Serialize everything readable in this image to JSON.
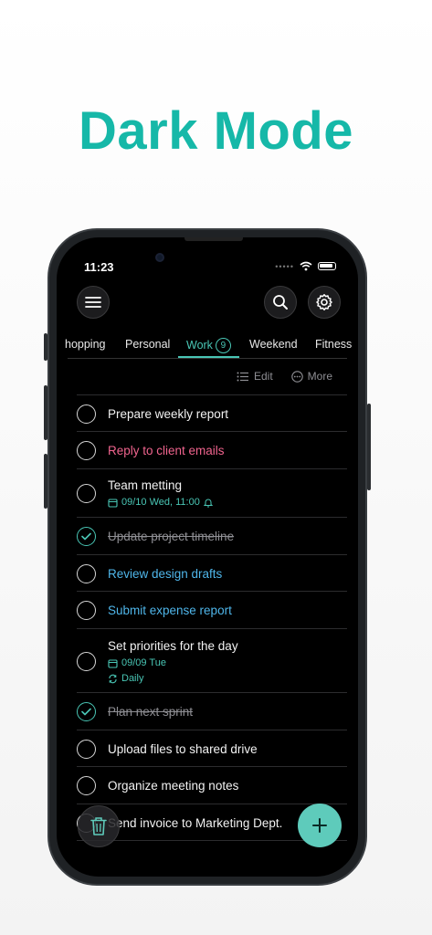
{
  "headline": "Dark Mode",
  "status": {
    "time": "11:23",
    "signal_dots": "•••••"
  },
  "header": {
    "menu_icon": "hamburger-icon",
    "search_icon": "search-icon",
    "settings_icon": "gear-icon"
  },
  "tabs": [
    {
      "label": "hopping",
      "active": false
    },
    {
      "label": "Personal",
      "active": false
    },
    {
      "label": "Work",
      "active": true,
      "count": "9"
    },
    {
      "label": "Weekend",
      "active": false
    },
    {
      "label": "Fitness",
      "active": false
    }
  ],
  "actions": {
    "edit_label": "Edit",
    "more_label": "More"
  },
  "tasks": [
    {
      "title": "Prepare weekly report",
      "done": false
    },
    {
      "title": "Reply to client emails",
      "done": false,
      "color": "#f0648e"
    },
    {
      "title": "Team metting",
      "done": false,
      "due": "09/10 Wed, 11:00",
      "reminder": true
    },
    {
      "title": "Update project timeline",
      "done": true
    },
    {
      "title": "Review design drafts",
      "done": false,
      "color": "#4fb6ea"
    },
    {
      "title": "Submit expense report",
      "done": false,
      "color": "#4fb6ea"
    },
    {
      "title": "Set priorities for the day",
      "done": false,
      "due": "09/09 Tue",
      "repeat": "Daily"
    },
    {
      "title": "Plan next sprint",
      "done": true
    },
    {
      "title": "Upload files to shared drive",
      "done": false
    },
    {
      "title": "Organize meeting notes",
      "done": false
    },
    {
      "title": "Send invoice to Marketing Dept.",
      "done": false
    }
  ],
  "colors": {
    "accent": "#49c6b5",
    "headline": "#16b8a8",
    "pink": "#f0648e",
    "blue": "#4fb6ea",
    "fab": "#5ecbbb"
  }
}
